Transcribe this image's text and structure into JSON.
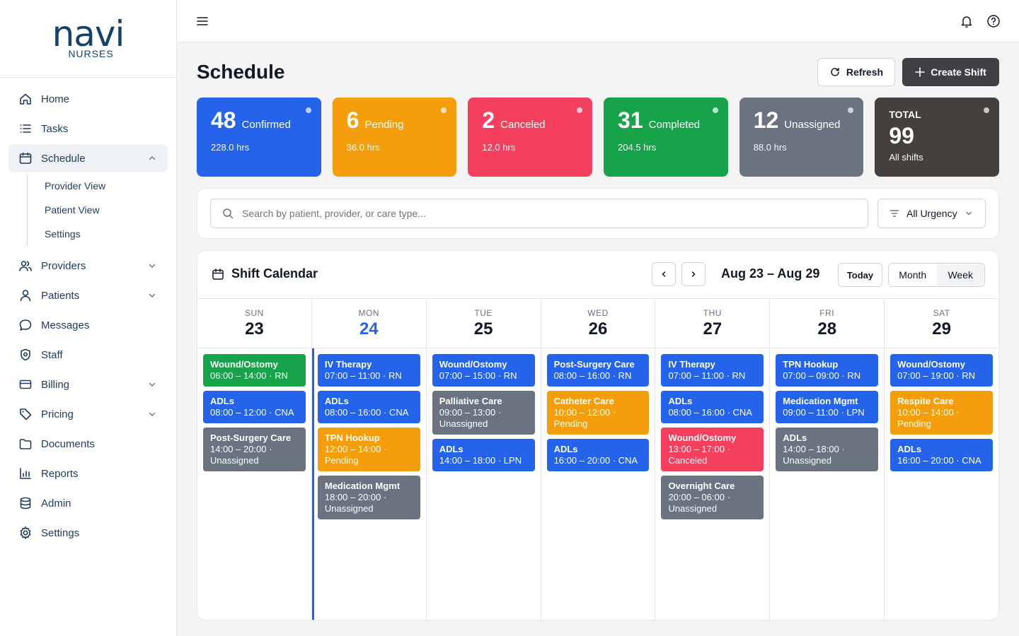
{
  "logo": {
    "word": "navi",
    "sub": "NURSES"
  },
  "sidebar": {
    "items": [
      {
        "label": "Home",
        "icon": "home-icon",
        "expand": false
      },
      {
        "label": "Tasks",
        "icon": "list-icon",
        "expand": false
      },
      {
        "label": "Schedule",
        "icon": "calendar-icon",
        "expand": "up",
        "active": true
      },
      {
        "label": "Providers",
        "icon": "users-icon",
        "expand": "down"
      },
      {
        "label": "Patients",
        "icon": "user-icon",
        "expand": "down"
      },
      {
        "label": "Messages",
        "icon": "message-icon",
        "expand": false
      },
      {
        "label": "Staff",
        "icon": "shield-icon",
        "expand": false
      },
      {
        "label": "Billing",
        "icon": "card-icon",
        "expand": "down"
      },
      {
        "label": "Pricing",
        "icon": "tag-icon",
        "expand": "down"
      },
      {
        "label": "Documents",
        "icon": "folder-icon",
        "expand": false
      },
      {
        "label": "Reports",
        "icon": "chart-icon",
        "expand": false
      },
      {
        "label": "Admin",
        "icon": "database-icon",
        "expand": false
      },
      {
        "label": "Settings",
        "icon": "gear-icon",
        "expand": false
      }
    ],
    "schedule_sub": [
      "Provider View",
      "Patient View",
      "Settings"
    ]
  },
  "page": {
    "title": "Schedule",
    "refresh_label": "Refresh",
    "create_label": "Create Shift"
  },
  "stats": [
    {
      "num": "48",
      "label": "Confirmed",
      "hrs": "228.0 hrs",
      "color": "#2563eb"
    },
    {
      "num": "6",
      "label": "Pending",
      "hrs": "36.0 hrs",
      "color": "#f59e0b"
    },
    {
      "num": "2",
      "label": "Canceled",
      "hrs": "12.0 hrs",
      "color": "#f43f5e"
    },
    {
      "num": "31",
      "label": "Completed",
      "hrs": "204.5 hrs",
      "color": "#16a34a"
    },
    {
      "num": "12",
      "label": "Unassigned",
      "hrs": "88.0 hrs",
      "color": "#6b7280"
    }
  ],
  "total": {
    "caption": "TOTAL",
    "num": "99",
    "sub": "All shifts",
    "color": "#44403c"
  },
  "search": {
    "placeholder": "Search by patient, provider, or care type..."
  },
  "urgency": {
    "label": "All Urgency"
  },
  "calendar": {
    "title": "Shift Calendar",
    "range": "Aug 23 – Aug 29",
    "today_label": "Today",
    "views": [
      "Month",
      "Week"
    ],
    "active_view": "Week",
    "colors": {
      "blue": "#2563eb",
      "green": "#16a34a",
      "gray": "#6b7280",
      "orange": "#f59e0b",
      "red": "#f43f5e"
    },
    "days": [
      {
        "name": "SUN",
        "num": "23",
        "shifts": [
          {
            "title": "Wound/Ostomy",
            "detail": "06:00 – 14:00 · RN",
            "color": "green"
          },
          {
            "title": "ADLs",
            "detail": "08:00 – 12:00 · CNA",
            "color": "blue"
          },
          {
            "title": "Post-Surgery Care",
            "detail": "14:00 – 20:00 · Unassigned",
            "color": "gray"
          }
        ]
      },
      {
        "name": "MON",
        "num": "24",
        "today": true,
        "shifts": [
          {
            "title": "IV Therapy",
            "detail": "07:00 – 11:00 · RN",
            "color": "blue"
          },
          {
            "title": "ADLs",
            "detail": "08:00 – 16:00 · CNA",
            "color": "blue"
          },
          {
            "title": "TPN Hookup",
            "detail": "12:00 – 14:00 · Pending",
            "color": "orange"
          },
          {
            "title": "Medication Mgmt",
            "detail": "18:00 – 20:00 · Unassigned",
            "color": "gray"
          }
        ]
      },
      {
        "name": "TUE",
        "num": "25",
        "shifts": [
          {
            "title": "Wound/Ostomy",
            "detail": "07:00 – 15:00 · RN",
            "color": "blue"
          },
          {
            "title": "Palliative Care",
            "detail": "09:00 – 13:00 · Unassigned",
            "color": "gray"
          },
          {
            "title": "ADLs",
            "detail": "14:00 – 18:00 · LPN",
            "color": "blue"
          }
        ]
      },
      {
        "name": "WED",
        "num": "26",
        "shifts": [
          {
            "title": "Post-Surgery Care",
            "detail": "08:00 – 16:00 · RN",
            "color": "blue"
          },
          {
            "title": "Catheter Care",
            "detail": "10:00 – 12:00 · Pending",
            "color": "orange"
          },
          {
            "title": "ADLs",
            "detail": "16:00 – 20:00 · CNA",
            "color": "blue"
          }
        ]
      },
      {
        "name": "THU",
        "num": "27",
        "shifts": [
          {
            "title": "IV Therapy",
            "detail": "07:00 – 11:00 · RN",
            "color": "blue"
          },
          {
            "title": "ADLs",
            "detail": "08:00 – 16:00 · CNA",
            "color": "blue"
          },
          {
            "title": "Wound/Ostomy",
            "detail": "13:00 – 17:00 · Canceled",
            "color": "red"
          },
          {
            "title": "Overnight Care",
            "detail": "20:00 – 06:00 · Unassigned",
            "color": "gray"
          }
        ]
      },
      {
        "name": "FRI",
        "num": "28",
        "shifts": [
          {
            "title": "TPN Hookup",
            "detail": "07:00 – 09:00 · RN",
            "color": "blue"
          },
          {
            "title": "Medication Mgmt",
            "detail": "09:00 – 11:00 · LPN",
            "color": "blue"
          },
          {
            "title": "ADLs",
            "detail": "14:00 – 18:00 · Unassigned",
            "color": "gray"
          }
        ]
      },
      {
        "name": "SAT",
        "num": "29",
        "shifts": [
          {
            "title": "Wound/Ostomy",
            "detail": "07:00 – 19:00 · RN",
            "color": "blue"
          },
          {
            "title": "Respite Care",
            "detail": "10:00 – 14:00 · Pending",
            "color": "orange"
          },
          {
            "title": "ADLs",
            "detail": "16:00 – 20:00 · CNA",
            "color": "blue"
          }
        ]
      }
    ]
  }
}
